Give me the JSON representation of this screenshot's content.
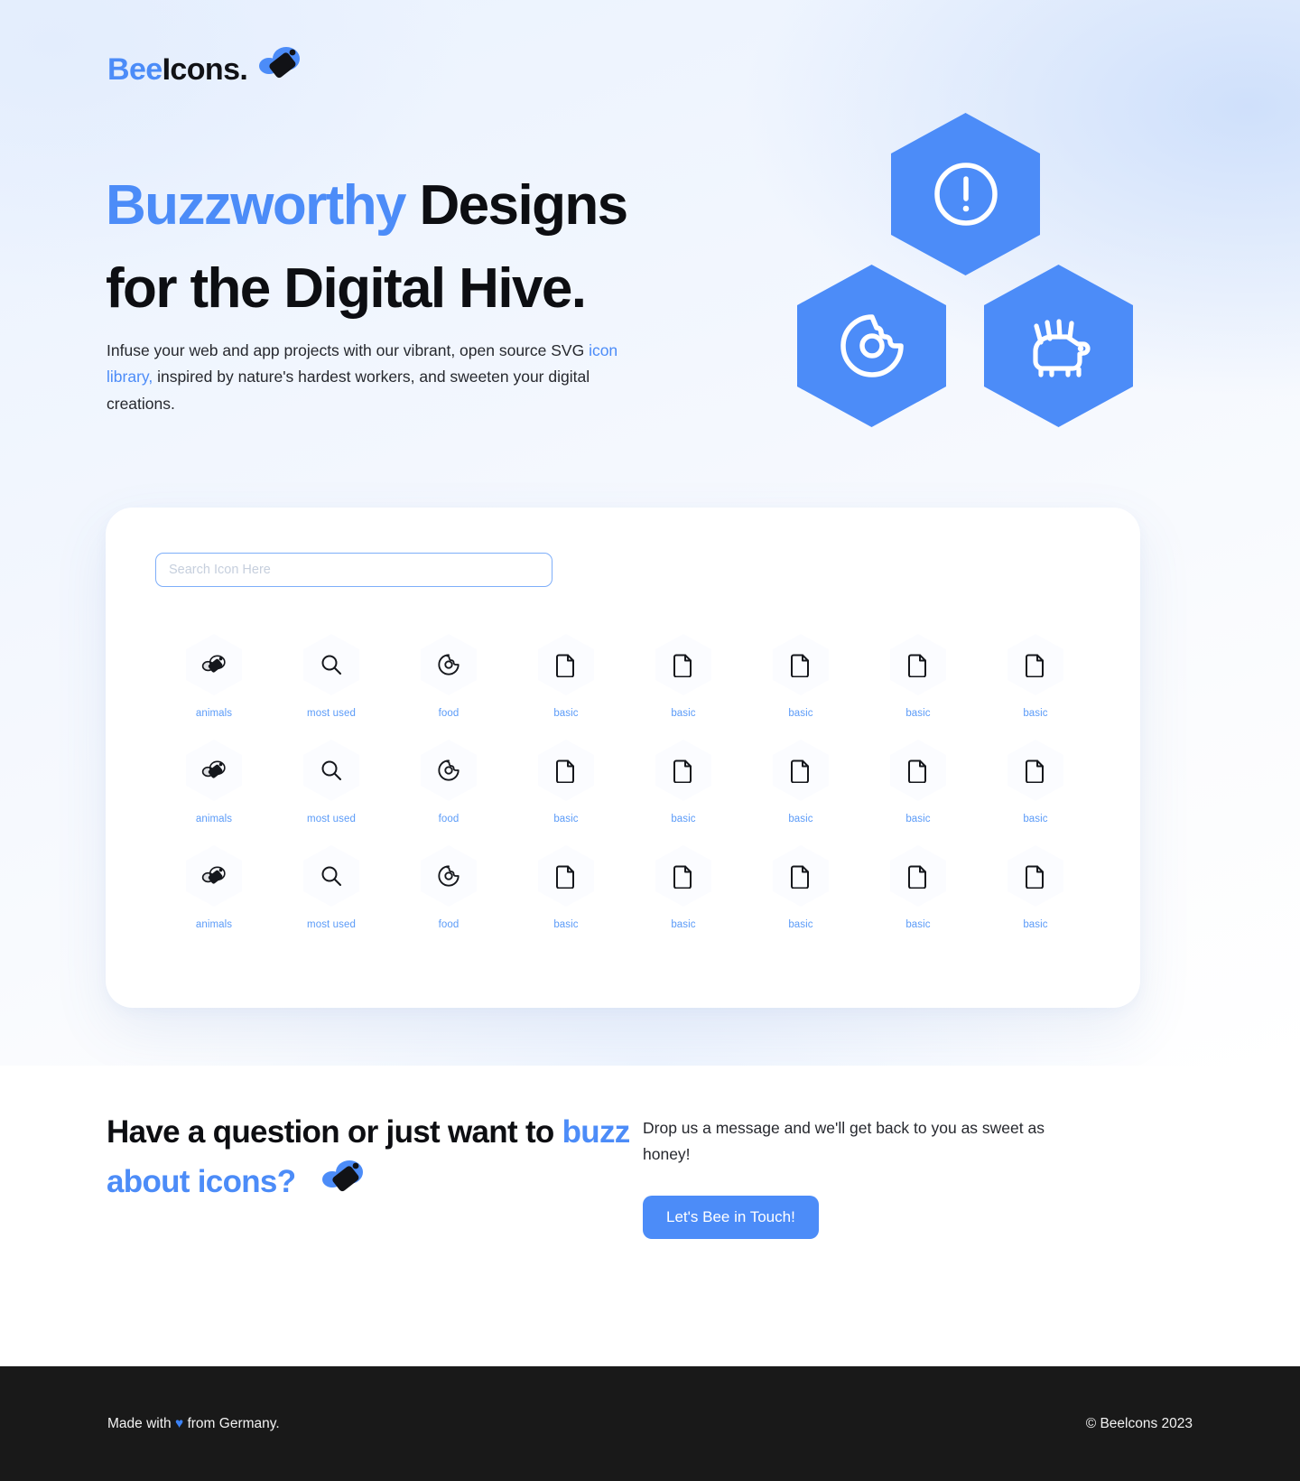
{
  "brand": {
    "name_blue": "Bee",
    "name_dark": "Icons.",
    "logo_icon": "bee-icon",
    "accent_color": "#4c8cf8",
    "dark_color": "#0d0e12"
  },
  "hero": {
    "headline_line1_highlight": "Buzzworthy",
    "headline_line1_rest": " Designs",
    "headline_line2": "for the Digital Hive.",
    "subtext_part1": "Infuse your web and app projects with our vibrant, open source SVG ",
    "subtext_link": "icon library,",
    "subtext_part2": " inspired by nature's hardest workers, and sweeten your digital creations.",
    "hexagons": [
      {
        "icon": "exclamation-circle-icon",
        "position": "top"
      },
      {
        "icon": "donut-icon",
        "position": "bottom-left"
      },
      {
        "icon": "hedgehog-icon",
        "position": "bottom-right"
      }
    ]
  },
  "browser": {
    "search": {
      "value": "",
      "placeholder": "Search Icon Here"
    },
    "icons": [
      {
        "icon": "bee-icon",
        "label": "animals"
      },
      {
        "icon": "search-icon",
        "label": "most used"
      },
      {
        "icon": "donut-icon",
        "label": "food"
      },
      {
        "icon": "file-icon",
        "label": "basic"
      },
      {
        "icon": "file-icon",
        "label": "basic"
      },
      {
        "icon": "file-icon",
        "label": "basic"
      },
      {
        "icon": "file-icon",
        "label": "basic"
      },
      {
        "icon": "file-icon",
        "label": "basic"
      },
      {
        "icon": "bee-icon",
        "label": "animals"
      },
      {
        "icon": "search-icon",
        "label": "most used"
      },
      {
        "icon": "donut-icon",
        "label": "food"
      },
      {
        "icon": "file-icon",
        "label": "basic"
      },
      {
        "icon": "file-icon",
        "label": "basic"
      },
      {
        "icon": "file-icon",
        "label": "basic"
      },
      {
        "icon": "file-icon",
        "label": "basic"
      },
      {
        "icon": "file-icon",
        "label": "basic"
      },
      {
        "icon": "bee-icon",
        "label": "animals"
      },
      {
        "icon": "search-icon",
        "label": "most used"
      },
      {
        "icon": "donut-icon",
        "label": "food"
      },
      {
        "icon": "file-icon",
        "label": "basic"
      },
      {
        "icon": "file-icon",
        "label": "basic"
      },
      {
        "icon": "file-icon",
        "label": "basic"
      },
      {
        "icon": "file-icon",
        "label": "basic"
      },
      {
        "icon": "file-icon",
        "label": "basic"
      }
    ]
  },
  "contact": {
    "heading_part1": "Have a question or just want to ",
    "heading_highlight": "buzz about icons?",
    "heading_icon": "bee-icon",
    "body": "Drop us a message and we'll get back to you as sweet as honey!",
    "cta_label": "Let's Bee in Touch!"
  },
  "footer": {
    "left_prefix": "Made with ",
    "heart": "♥",
    "left_suffix": " from Germany.",
    "right": "© Beelcons 2023"
  }
}
